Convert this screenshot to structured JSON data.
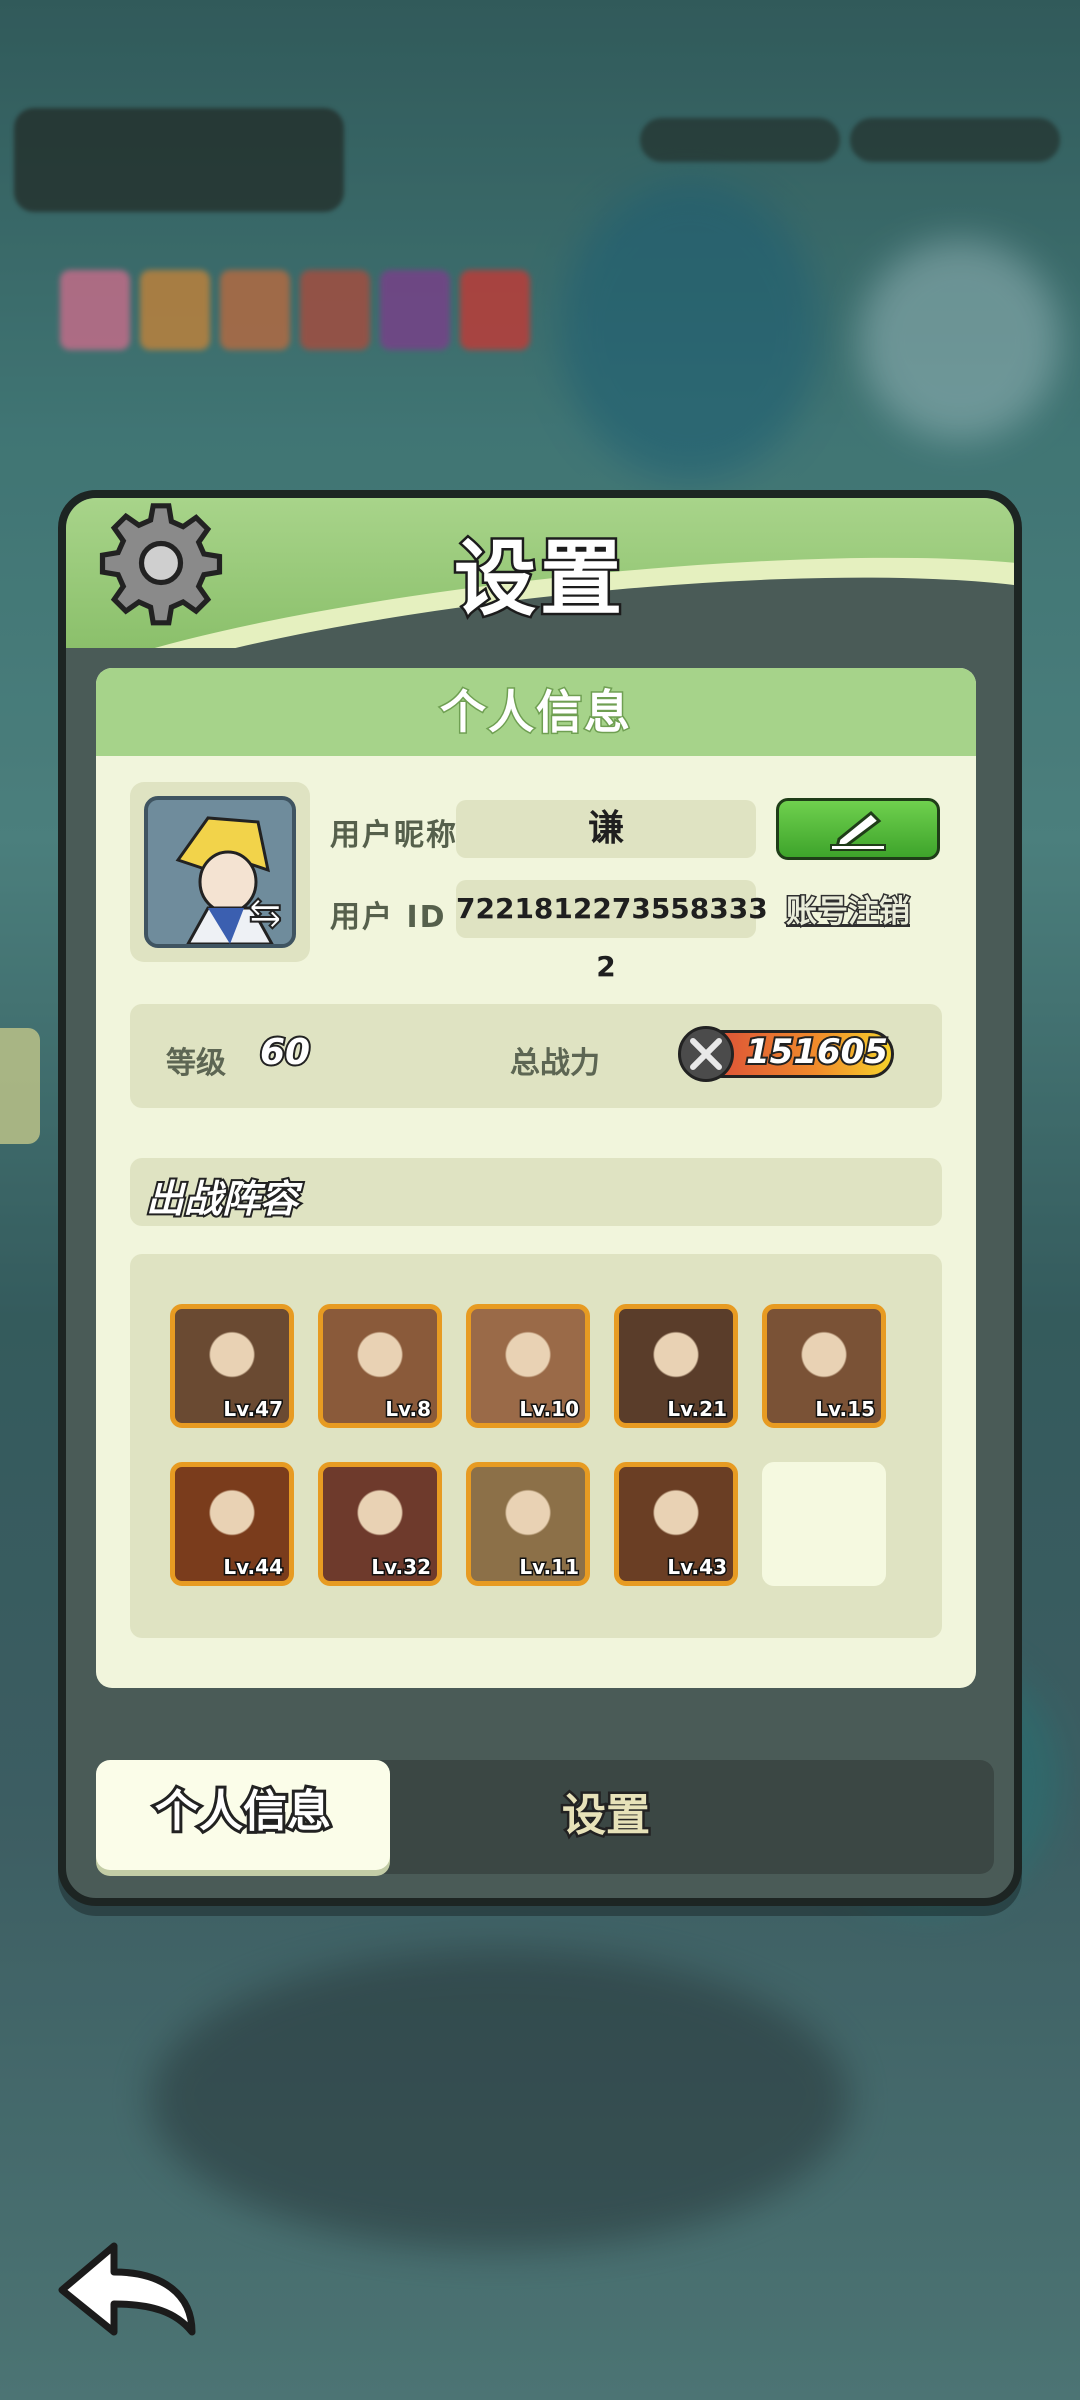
{
  "panel": {
    "title": "设置"
  },
  "content": {
    "header": "个人信息"
  },
  "profile": {
    "nickname_label": "用户昵称",
    "nickname": "谦",
    "id_label": "用户 ID",
    "id": "7221812273558333 2",
    "deregister_label": "账号注销"
  },
  "stats": {
    "level_label": "等级",
    "level": "60",
    "power_label": "总战力",
    "power": "151605"
  },
  "lineup": {
    "title": "出战阵容",
    "heroes": [
      {
        "level": "Lv.47",
        "color": "#6a4a32"
      },
      {
        "level": "Lv.8",
        "color": "#8a5a3a"
      },
      {
        "level": "Lv.10",
        "color": "#9a6a48"
      },
      {
        "level": "Lv.21",
        "color": "#5a3d2a"
      },
      {
        "level": "Lv.15",
        "color": "#7a5236"
      },
      {
        "level": "Lv.44",
        "color": "#7a3c1c"
      },
      {
        "level": "Lv.32",
        "color": "#6e3a2c"
      },
      {
        "level": "Lv.11",
        "color": "#8c7048"
      },
      {
        "level": "Lv.43",
        "color": "#6a3e24"
      }
    ]
  },
  "tabs": {
    "active": "个人信息",
    "other": "设置"
  },
  "icons": {
    "gear": "gear-icon",
    "edit": "pencil-icon",
    "swap": "swap-icon",
    "sword": "crossed-swords-icon",
    "back": "back-arrow-icon"
  }
}
